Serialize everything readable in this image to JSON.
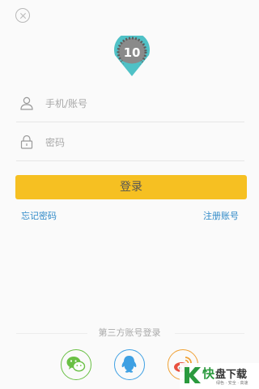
{
  "login_form": {
    "account_placeholder": "手机/账号",
    "account_value": "",
    "password_placeholder": "密码",
    "password_value": "",
    "login_label": "登录"
  },
  "links": {
    "forgot_password": "忘记密码",
    "register": "注册账号"
  },
  "logo": {
    "text": "10",
    "colors": {
      "pin": "#4fc1c6",
      "badge": "#8a8a8a"
    }
  },
  "third_party": {
    "title": "第三方账号登录",
    "providers": [
      {
        "name": "wechat",
        "icon": "wechat-icon",
        "color": "#6ac045"
      },
      {
        "name": "qq",
        "icon": "qq-icon",
        "color": "#3ea0e3"
      },
      {
        "name": "weibo",
        "icon": "weibo-icon",
        "color": "#f0a135"
      }
    ]
  },
  "watermark": {
    "char": "快",
    "name": "盘下载",
    "sub": "绿色 · 安全 · 高速"
  },
  "colors": {
    "accent": "#f6c022",
    "link": "#2f8ac8"
  }
}
